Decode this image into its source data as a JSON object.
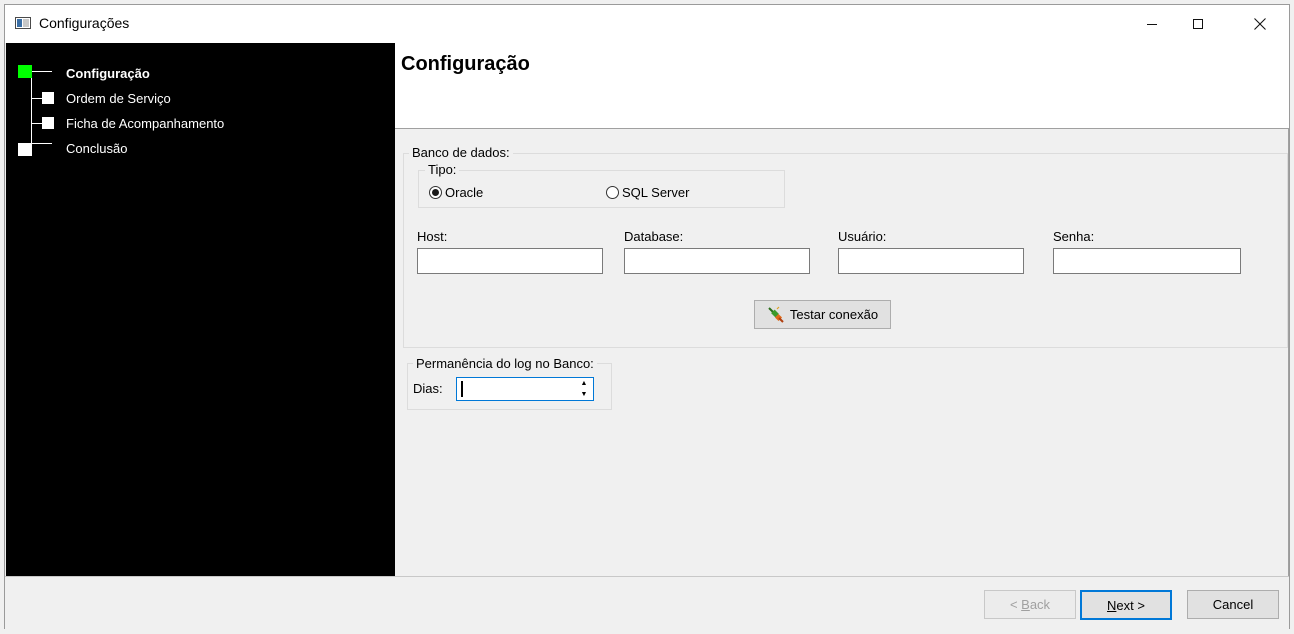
{
  "window": {
    "title": "Configurações"
  },
  "sidebar": {
    "items": [
      {
        "label": "Configuração",
        "active": true
      },
      {
        "label": "Ordem de Serviço",
        "active": false
      },
      {
        "label": "Ficha de Acompanhamento",
        "active": false
      },
      {
        "label": "Conclusão",
        "active": false
      }
    ],
    "active_color": "#00ff00"
  },
  "header": {
    "title": "Configuração"
  },
  "database": {
    "group_label": "Banco de dados:",
    "type_group_label": "Tipo:",
    "options": [
      {
        "label": "Oracle",
        "selected": true
      },
      {
        "label": "SQL Server",
        "selected": false
      }
    ],
    "fields": {
      "host_label": "Host:",
      "database_label": "Database:",
      "user_label": "Usuário:",
      "password_label": "Senha:",
      "host_value": "",
      "database_value": "",
      "user_value": "",
      "password_value": ""
    },
    "test_button": "Testar conexão"
  },
  "log": {
    "group_label": "Permanência do log no Banco:",
    "days_label": "Dias:",
    "days_value": ""
  },
  "footer": {
    "back_prefix": "< ",
    "back_accel": "B",
    "back_rest": "ack",
    "next_accel": "N",
    "next_rest": "ext >",
    "cancel": "Cancel"
  },
  "colors": {
    "accent": "#0078d7",
    "sidebar_bg": "#000000"
  }
}
